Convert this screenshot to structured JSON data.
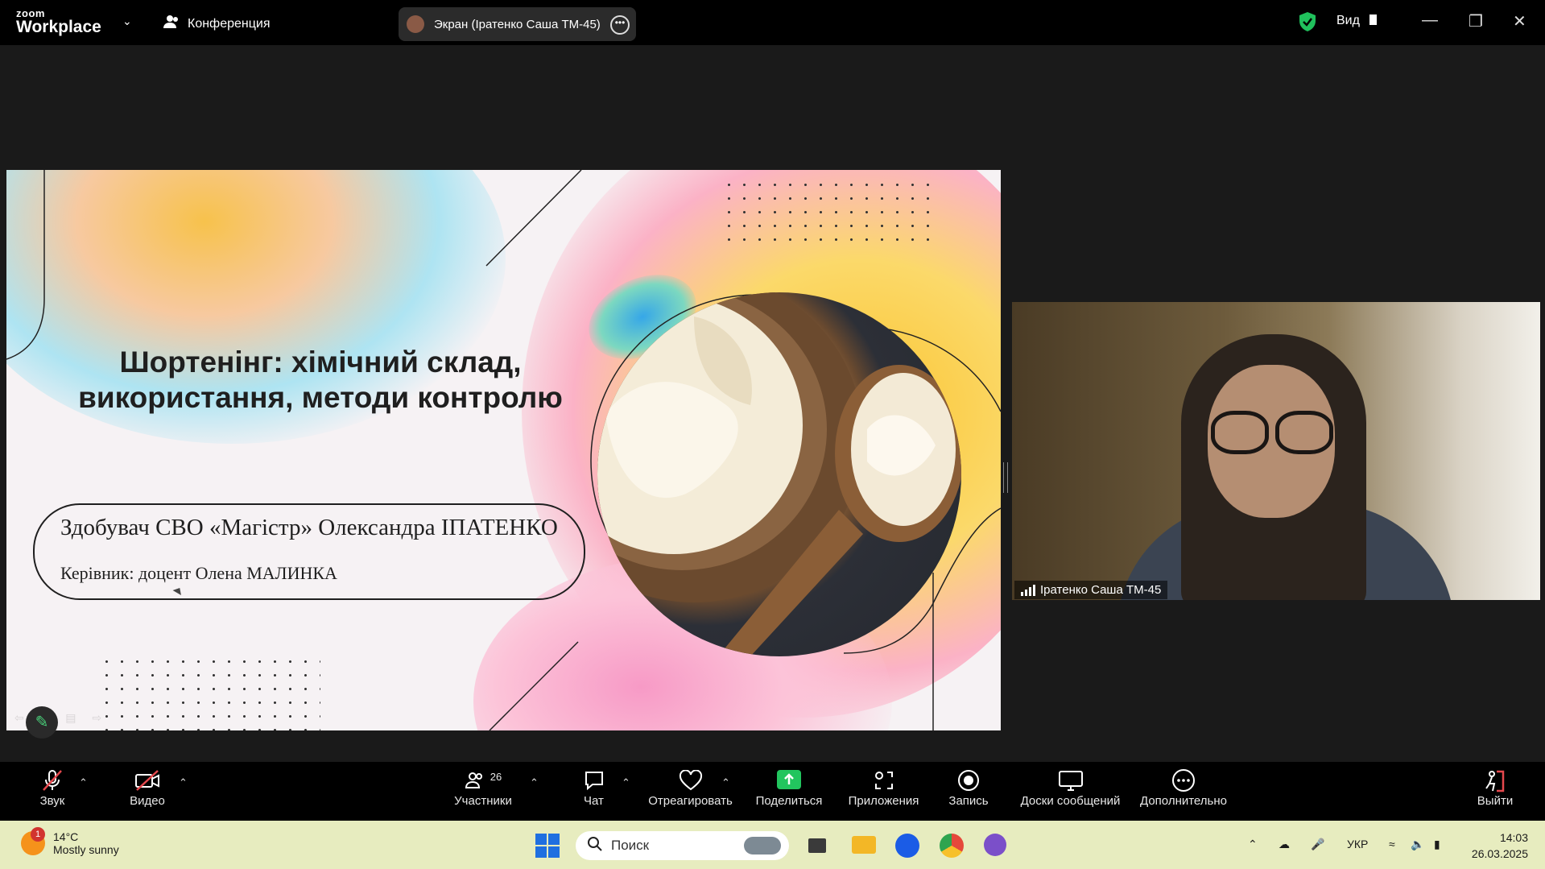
{
  "titlebar": {
    "logo_top": "zoom",
    "logo_bottom": "Workplace",
    "conference_label": "Конференция",
    "screen_share_label": "Экран (Ipатенко Саша ТМ-45)",
    "view_label": "Вид"
  },
  "slide": {
    "title": "Шортенінг: хімічний склад, використання, методи контролю",
    "author": "Здобувач СВО «Магістр» Олександра ІПАТЕНКО",
    "supervisor": "Керівник: доцент Олена МАЛИНКА"
  },
  "video": {
    "participant_name": "Ipатенко Саша ТМ-45"
  },
  "toolbar": {
    "audio": "Звук",
    "video": "Видео",
    "participants": "Участники",
    "participants_count": "26",
    "chat": "Чат",
    "react": "Отреагировать",
    "share": "Поделиться",
    "apps": "Приложения",
    "record": "Запись",
    "whiteboards": "Доски сообщений",
    "more": "Дополнительно",
    "leave": "Выйти"
  },
  "taskbar": {
    "weather_badge": "1",
    "temperature": "14°C",
    "weather_desc": "Mostly sunny",
    "search_placeholder": "Поиск",
    "language": "УКР",
    "time": "14:03",
    "date": "26.03.2025"
  },
  "colors": {
    "accent_green": "#20c05c",
    "share_green": "#22c55e",
    "leave_red": "#e5484d",
    "mute_red": "#e5484d"
  }
}
